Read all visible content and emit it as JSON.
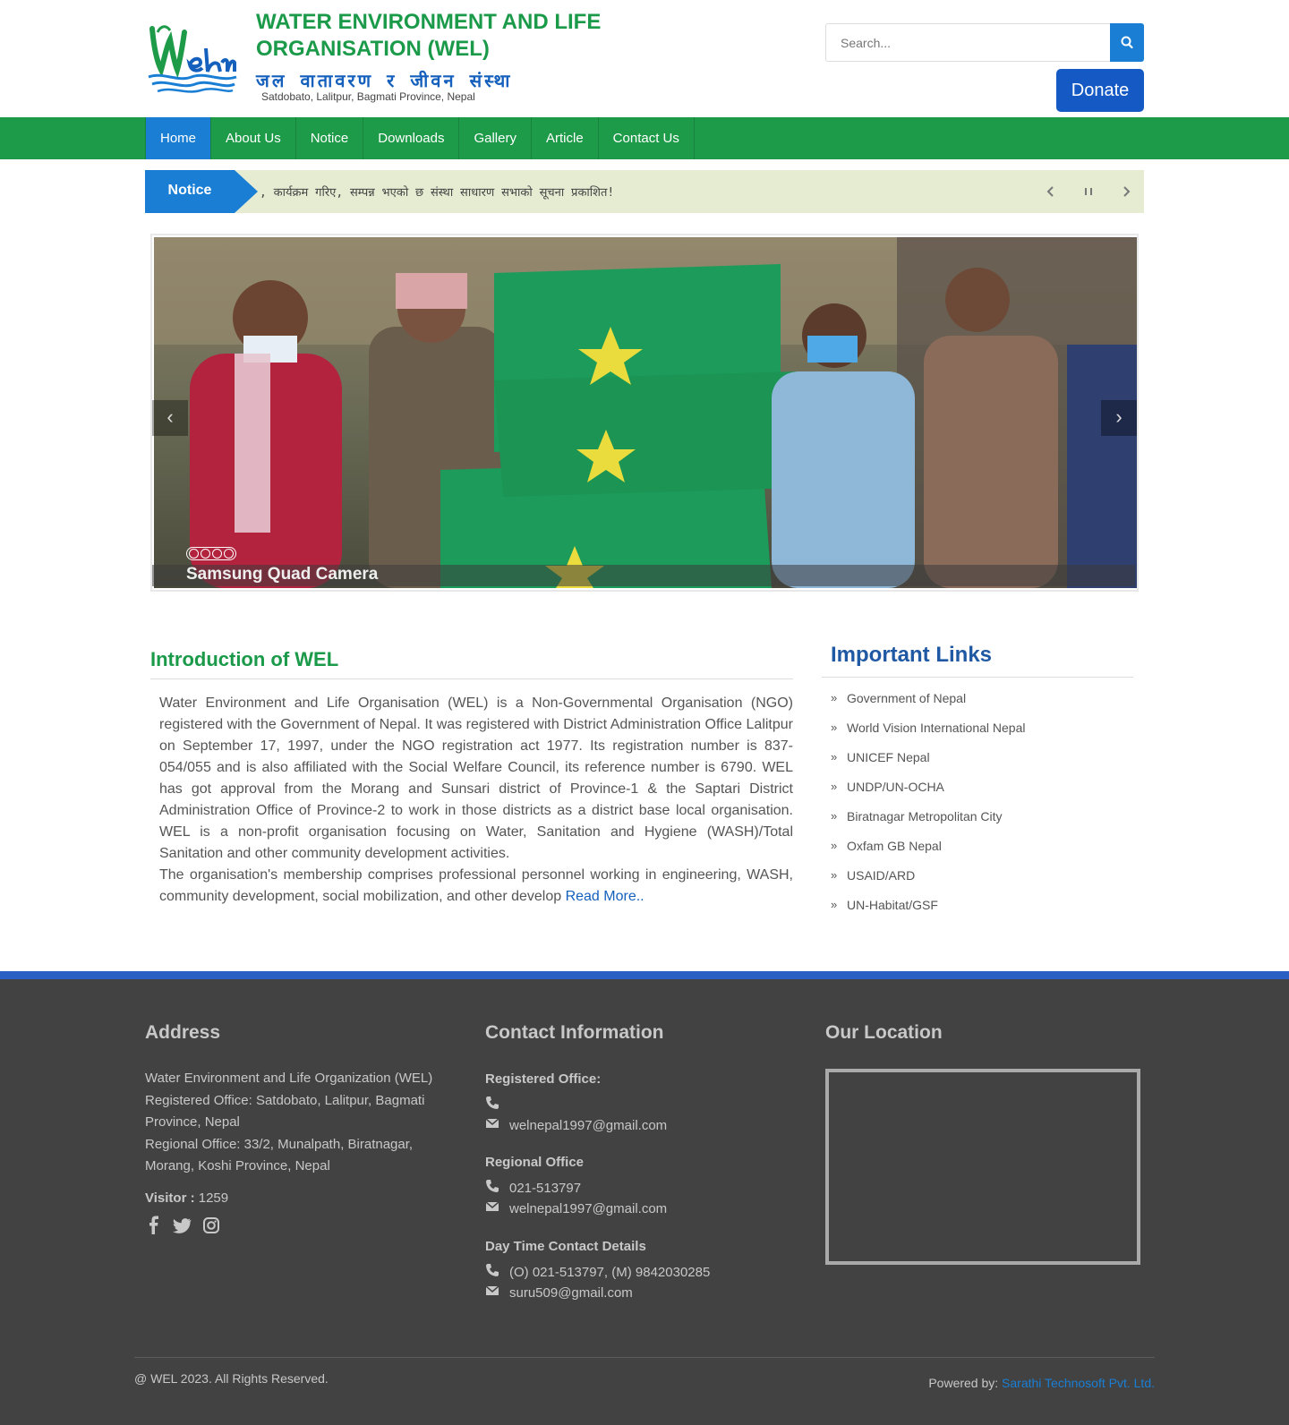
{
  "header": {
    "title": "WATER ENVIRONMENT AND LIFE ORGANISATION (WEL)",
    "nepali_title": "जल वातावरण र जीवन संस्था",
    "address": "Satdobato, Lalitpur, Bagmati Province, Nepal",
    "search_placeholder": "Search...",
    "donate_label": "Donate"
  },
  "nav": {
    "items": [
      "Home",
      "About Us",
      "Notice",
      "Downloads",
      "Gallery",
      "Article",
      "Contact Us"
    ],
    "active": "Home"
  },
  "ticker": {
    "label": "Notice",
    "text": ", कार्यक्रम गरिए, सम्पन्न भएको छ संस्था साधारण सभाको सूचना प्रकाशित!"
  },
  "slider": {
    "caption": "Samsung Quad Camera",
    "dots": 4,
    "prev": "‹",
    "next": "›"
  },
  "intro": {
    "title": "Introduction of WEL",
    "paragraph1": "Water Environment and Life Organisation (WEL) is a Non-Governmental Organisation (NGO) registered with the Government of Nepal. It was registered with District Administration Office Lalitpur on September 17, 1997, under the NGO registration act 1977. Its registration number is 837-054/055 and is also affiliated with the Social Welfare Council, its reference number is 6790.  WEL has got approval from the Morang and Sunsari district of Province-1 & the Saptari District Administration Office of Province-2 to work in those districts as a district base local organisation. WEL is a non-profit organisation focusing on Water, Sanitation and Hygiene (WASH)/Total Sanitation and other community development activities.",
    "paragraph2": "The organisation's membership comprises professional personnel working in engineering, WASH, community development, social mobilization, and other develop ",
    "read_more": "Read More.."
  },
  "important_links": {
    "title": "Important Links",
    "items": [
      "Government of Nepal",
      "World Vision International Nepal",
      "UNICEF Nepal",
      "UNDP/UN-OCHA",
      "Biratnagar Metropolitan City",
      "Oxfam GB Nepal",
      "USAID/ARD",
      "UN-Habitat/GSF"
    ]
  },
  "footer": {
    "address_title": "Address",
    "address_lines": [
      "Water Environment and Life Organization (WEL)",
      "Registered Office: Satdobato, Lalitpur, Bagmati Province, Nepal",
      "Regional Office: 33/2, Munalpath, Biratnagar, Morang, Koshi Province, Nepal"
    ],
    "visitor_label": "Visitor :",
    "visitor_count": "1259",
    "contact_title": "Contact Information",
    "registered_office_label": "Registered Office:",
    "registered_phone": "",
    "registered_email": "welnepal1997@gmail.com",
    "regional_office_label": "Regional Office",
    "regional_phone": "021-513797",
    "regional_email": "welnepal1997@gmail.com",
    "daytime_label": "Day Time Contact Details",
    "daytime_phone": "(O) 021-513797, (M) 9842030285",
    "daytime_email": "suru509@gmail.com",
    "location_title": "Our Location",
    "copyright": "@ WEL 2023. All Rights Reserved.",
    "powered_by_label": "Powered by:",
    "powered_by_name": "Sarathi Technosoft Pvt. Ltd."
  },
  "colors": {
    "brand_green": "#1e9b48",
    "brand_blue": "#1a7fd4",
    "donate_blue": "#1559c5",
    "footer_bg": "#424242"
  }
}
